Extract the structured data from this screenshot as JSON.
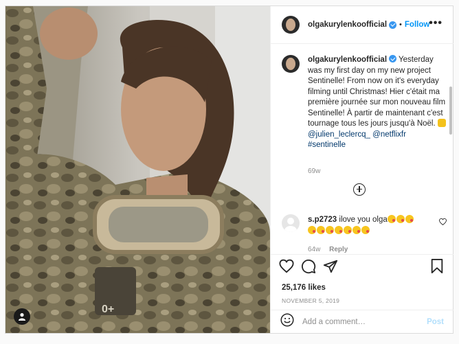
{
  "header": {
    "username": "olgakurylenkoofficial",
    "separator": "•",
    "follow_label": "Follow",
    "more_label": "•••"
  },
  "caption": {
    "username": "olgakurylenkoofficial",
    "text": "Yesterday was my first day on my new project Sentinelle! From now on it's everyday filming until Christmas! Hier c'était ma première journée sur mon nouveau film Sentinelle! À partir de maintenant c'est tournage tous les jours jusqu'à Noël.",
    "mention_1": "@julien_leclercq_",
    "mention_2": "@netflixfr",
    "hashtag": "#sentinelle",
    "age": "69w"
  },
  "comment": {
    "username": "s.p2723",
    "text": "ilove you olga",
    "age": "64w",
    "reply_label": "Reply"
  },
  "post": {
    "likes": "25,176 likes",
    "date": "NOVEMBER 5, 2019"
  },
  "add_comment": {
    "placeholder": "Add a comment…",
    "post_label": "Post"
  },
  "icons": {
    "like": "heart-icon",
    "comment": "comment-icon",
    "share": "paper-plane-icon",
    "save": "bookmark-icon",
    "emoji": "smiley-icon",
    "load_more": "plus-circle-icon",
    "tag": "user-tag-icon"
  },
  "colors": {
    "accent": "#0095f6",
    "verified": "#3897f0",
    "muted": "#8e8e8e",
    "post_disabled": "#b2dffc"
  }
}
